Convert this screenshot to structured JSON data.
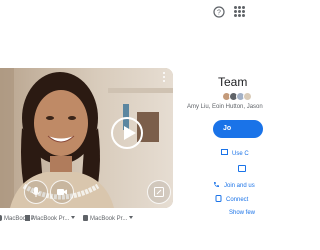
{
  "meeting": {
    "title": "Team",
    "participants": "Amy Liu, Eoin Hutton, Jason",
    "join_label": "Jo"
  },
  "other_options": [
    {
      "label": "Use C",
      "icon": "present-icon"
    },
    {
      "label": "Join and us",
      "icon": "phone-icon"
    },
    {
      "label": "Connect",
      "icon": "companion-icon"
    },
    {
      "label": "Show few",
      "icon": ""
    }
  ],
  "devices": [
    {
      "label": "MacBook P",
      "icon": "microphone-icon"
    },
    {
      "label": "MacBook Pr...",
      "icon": "speaker-icon"
    },
    {
      "label": "MacBook Pr...",
      "icon": "camera-icon"
    }
  ],
  "colors": {
    "accent": "#1a73e8",
    "text": "#202124",
    "muted": "#5f6368"
  }
}
